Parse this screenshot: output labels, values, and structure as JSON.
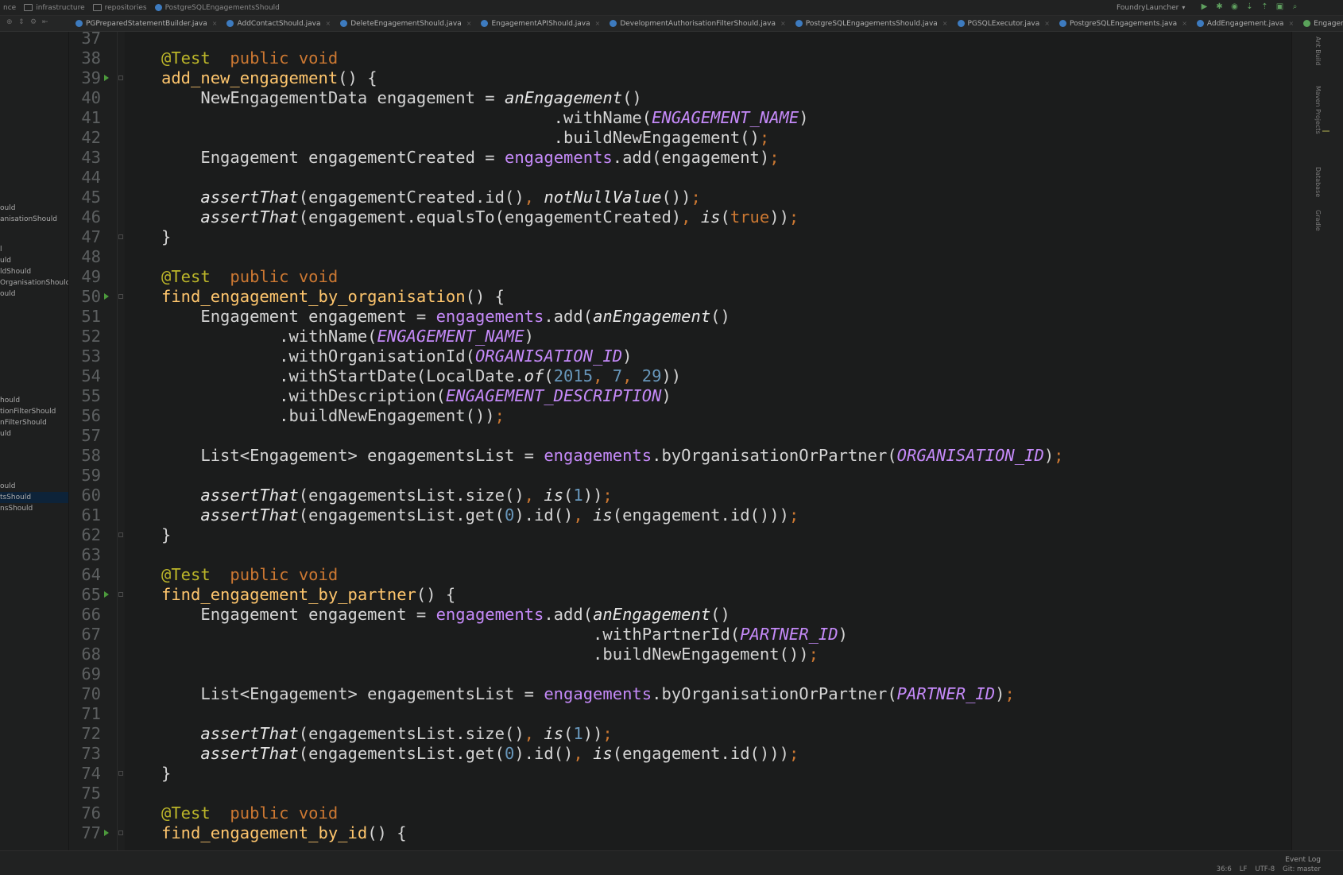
{
  "breadcrumbs": [
    "nce",
    "infrastructure",
    "repositories",
    "PostgreSQLEngagementsShould"
  ],
  "run_config": "FoundryLauncher",
  "tabs": [
    {
      "label": "PGPreparedStatementBuilder.java",
      "kind": "class"
    },
    {
      "label": "AddContactShould.java",
      "kind": "class"
    },
    {
      "label": "DeleteEngagementShould.java",
      "kind": "class"
    },
    {
      "label": "EngagementAPIShould.java",
      "kind": "class"
    },
    {
      "label": "DevelopmentAuthorisationFilterShould.java",
      "kind": "class"
    },
    {
      "label": "PostgreSQLEngagementsShould.java",
      "kind": "class"
    },
    {
      "label": "PGSQLExecutor.java",
      "kind": "class"
    },
    {
      "label": "PostgreSQLEngagements.java",
      "kind": "class"
    },
    {
      "label": "AddEngagement.java",
      "kind": "class"
    },
    {
      "label": "Engagements.java",
      "kind": "interface"
    }
  ],
  "sidebar_items": [
    {
      "label": "ould",
      "selected": false
    },
    {
      "label": "anisationShould",
      "selected": false
    },
    {
      "label": "l",
      "selected": false
    },
    {
      "label": "uld",
      "selected": false
    },
    {
      "label": "ldShould",
      "selected": false
    },
    {
      "label": "OrganisationShould",
      "selected": false
    },
    {
      "label": "ould",
      "selected": false
    },
    {
      "label": "hould",
      "selected": false
    },
    {
      "label": "tionFilterShould",
      "selected": false
    },
    {
      "label": "nFilterShould",
      "selected": false
    },
    {
      "label": "uld",
      "selected": false
    },
    {
      "label": "ould",
      "selected": false
    },
    {
      "label": "tsShould",
      "selected": true
    },
    {
      "label": "nsShould",
      "selected": false
    }
  ],
  "code": {
    "line_numbers": [
      "37",
      "38",
      "39",
      "40",
      "41",
      "42",
      "43",
      "44",
      "45",
      "46",
      "47",
      "48",
      "49",
      "50",
      "51",
      "52",
      "53",
      "54",
      "55",
      "56",
      "57",
      "58",
      "59",
      "60",
      "61",
      "62",
      "63",
      "64",
      "65",
      "66",
      "67",
      "68",
      "69",
      "70",
      "71",
      "72",
      "73",
      "74",
      "75",
      "76",
      "77"
    ],
    "lines": [
      [],
      [
        [
          "ann",
          "@Test"
        ],
        [
          "",
          "  "
        ],
        [
          "kw",
          "public"
        ],
        [
          "",
          " "
        ],
        [
          "kw",
          "void"
        ]
      ],
      [
        [
          "fn",
          "add_new_engagement"
        ],
        [
          "",
          "() {"
        ]
      ],
      [
        [
          "",
          "    NewEngagementData engagement = "
        ],
        [
          "sm",
          "anEngagement"
        ],
        [
          "",
          "()"
        ]
      ],
      [
        [
          "",
          "                                        .withName("
        ],
        [
          "const",
          "ENGAGEMENT_NAME"
        ],
        [
          "",
          ")"
        ]
      ],
      [
        [
          "",
          "                                        .buildNewEngagement()"
        ],
        [
          "semi",
          ";"
        ]
      ],
      [
        [
          "",
          "    Engagement engagementCreated = "
        ],
        [
          "field",
          "engagements"
        ],
        [
          "",
          ".add(engagement)"
        ],
        [
          "semi",
          ";"
        ]
      ],
      [],
      [
        [
          "",
          "    "
        ],
        [
          "sm",
          "assertThat"
        ],
        [
          "",
          "(engagementCreated.id()"
        ],
        [
          "semi",
          ","
        ],
        [
          "",
          " "
        ],
        [
          "sm",
          "notNullValue"
        ],
        [
          "",
          "())"
        ],
        [
          "semi",
          ";"
        ]
      ],
      [
        [
          "",
          "    "
        ],
        [
          "sm",
          "assertThat"
        ],
        [
          "",
          "(engagement.equalsTo(engagementCreated)"
        ],
        [
          "semi",
          ","
        ],
        [
          "",
          " "
        ],
        [
          "sm",
          "is"
        ],
        [
          "",
          "("
        ],
        [
          "kw",
          "true"
        ],
        [
          "",
          "))"
        ],
        [
          "semi",
          ";"
        ]
      ],
      [
        [
          "",
          "}"
        ]
      ],
      [],
      [
        [
          "ann",
          "@Test"
        ],
        [
          "",
          "  "
        ],
        [
          "kw",
          "public"
        ],
        [
          "",
          " "
        ],
        [
          "kw",
          "void"
        ]
      ],
      [
        [
          "fn",
          "find_engagement_by_organisation"
        ],
        [
          "",
          "() {"
        ]
      ],
      [
        [
          "",
          "    Engagement engagement = "
        ],
        [
          "field",
          "engagements"
        ],
        [
          "",
          ".add("
        ],
        [
          "sm",
          "anEngagement"
        ],
        [
          "",
          "()"
        ]
      ],
      [
        [
          "",
          "            .withName("
        ],
        [
          "const",
          "ENGAGEMENT_NAME"
        ],
        [
          "",
          ")"
        ]
      ],
      [
        [
          "",
          "            .withOrganisationId("
        ],
        [
          "const",
          "ORGANISATION_ID"
        ],
        [
          "",
          ")"
        ]
      ],
      [
        [
          "",
          "            .withStartDate(LocalDate."
        ],
        [
          "sm",
          "of"
        ],
        [
          "",
          "("
        ],
        [
          "num",
          "2015"
        ],
        [
          "semi",
          ","
        ],
        [
          "",
          " "
        ],
        [
          "num",
          "7"
        ],
        [
          "semi",
          ","
        ],
        [
          "",
          " "
        ],
        [
          "num",
          "29"
        ],
        [
          "",
          "))"
        ]
      ],
      [
        [
          "",
          "            .withDescription("
        ],
        [
          "const",
          "ENGAGEMENT_DESCRIPTION"
        ],
        [
          "",
          ")"
        ]
      ],
      [
        [
          "",
          "            .buildNewEngagement())"
        ],
        [
          "semi",
          ";"
        ]
      ],
      [],
      [
        [
          "",
          "    List<Engagement> engagementsList = "
        ],
        [
          "field",
          "engagements"
        ],
        [
          "",
          ".byOrganisationOrPartner("
        ],
        [
          "const",
          "ORGANISATION_ID"
        ],
        [
          "",
          ")"
        ],
        [
          "semi",
          ";"
        ]
      ],
      [],
      [
        [
          "",
          "    "
        ],
        [
          "sm",
          "assertThat"
        ],
        [
          "",
          "(engagementsList.size()"
        ],
        [
          "semi",
          ","
        ],
        [
          "",
          " "
        ],
        [
          "sm",
          "is"
        ],
        [
          "",
          "("
        ],
        [
          "num",
          "1"
        ],
        [
          "",
          "))"
        ],
        [
          "semi",
          ";"
        ]
      ],
      [
        [
          "",
          "    "
        ],
        [
          "sm",
          "assertThat"
        ],
        [
          "",
          "(engagementsList.get("
        ],
        [
          "num",
          "0"
        ],
        [
          "",
          ").id()"
        ],
        [
          "semi",
          ","
        ],
        [
          "",
          " "
        ],
        [
          "sm",
          "is"
        ],
        [
          "",
          "(engagement.id()))"
        ],
        [
          "semi",
          ";"
        ]
      ],
      [
        [
          "",
          "}"
        ]
      ],
      [],
      [
        [
          "ann",
          "@Test"
        ],
        [
          "",
          "  "
        ],
        [
          "kw",
          "public"
        ],
        [
          "",
          " "
        ],
        [
          "kw",
          "void"
        ]
      ],
      [
        [
          "fn",
          "find_engagement_by_partner"
        ],
        [
          "",
          "() {"
        ]
      ],
      [
        [
          "",
          "    Engagement engagement = "
        ],
        [
          "field",
          "engagements"
        ],
        [
          "",
          ".add("
        ],
        [
          "sm",
          "anEngagement"
        ],
        [
          "",
          "()"
        ]
      ],
      [
        [
          "",
          "                                            .withPartnerId("
        ],
        [
          "const",
          "PARTNER_ID"
        ],
        [
          "",
          ")"
        ]
      ],
      [
        [
          "",
          "                                            .buildNewEngagement())"
        ],
        [
          "semi",
          ";"
        ]
      ],
      [],
      [
        [
          "",
          "    List<Engagement> engagementsList = "
        ],
        [
          "field",
          "engagements"
        ],
        [
          "",
          ".byOrganisationOrPartner("
        ],
        [
          "const",
          "PARTNER_ID"
        ],
        [
          "",
          ")"
        ],
        [
          "semi",
          ";"
        ]
      ],
      [],
      [
        [
          "",
          "    "
        ],
        [
          "sm",
          "assertThat"
        ],
        [
          "",
          "(engagementsList.size()"
        ],
        [
          "semi",
          ","
        ],
        [
          "",
          " "
        ],
        [
          "sm",
          "is"
        ],
        [
          "",
          "("
        ],
        [
          "num",
          "1"
        ],
        [
          "",
          "))"
        ],
        [
          "semi",
          ";"
        ]
      ],
      [
        [
          "",
          "    "
        ],
        [
          "sm",
          "assertThat"
        ],
        [
          "",
          "(engagementsList.get("
        ],
        [
          "num",
          "0"
        ],
        [
          "",
          ").id()"
        ],
        [
          "semi",
          ","
        ],
        [
          "",
          " "
        ],
        [
          "sm",
          "is"
        ],
        [
          "",
          "(engagement.id()))"
        ],
        [
          "semi",
          ";"
        ]
      ],
      [
        [
          "",
          "}"
        ]
      ],
      [],
      [
        [
          "ann",
          "@Test"
        ],
        [
          "",
          "  "
        ],
        [
          "kw",
          "public"
        ],
        [
          "",
          " "
        ],
        [
          "kw",
          "void"
        ]
      ],
      [
        [
          "fn",
          "find_engagement_by_id"
        ],
        [
          "",
          "() {"
        ]
      ]
    ],
    "run_markers": [
      "39",
      "50",
      "65",
      "77"
    ],
    "fold_markers": [
      "39",
      "47",
      "50",
      "62",
      "65",
      "74",
      "77"
    ]
  },
  "right_tool_windows": [
    "Ant Build",
    "Maven Projects",
    "Database",
    "Gradle"
  ],
  "status_bar": {
    "event_log": "Event Log",
    "position": "36:6",
    "line_sep": "LF",
    "encoding": "UTF-8",
    "vcs": "Git: master"
  }
}
